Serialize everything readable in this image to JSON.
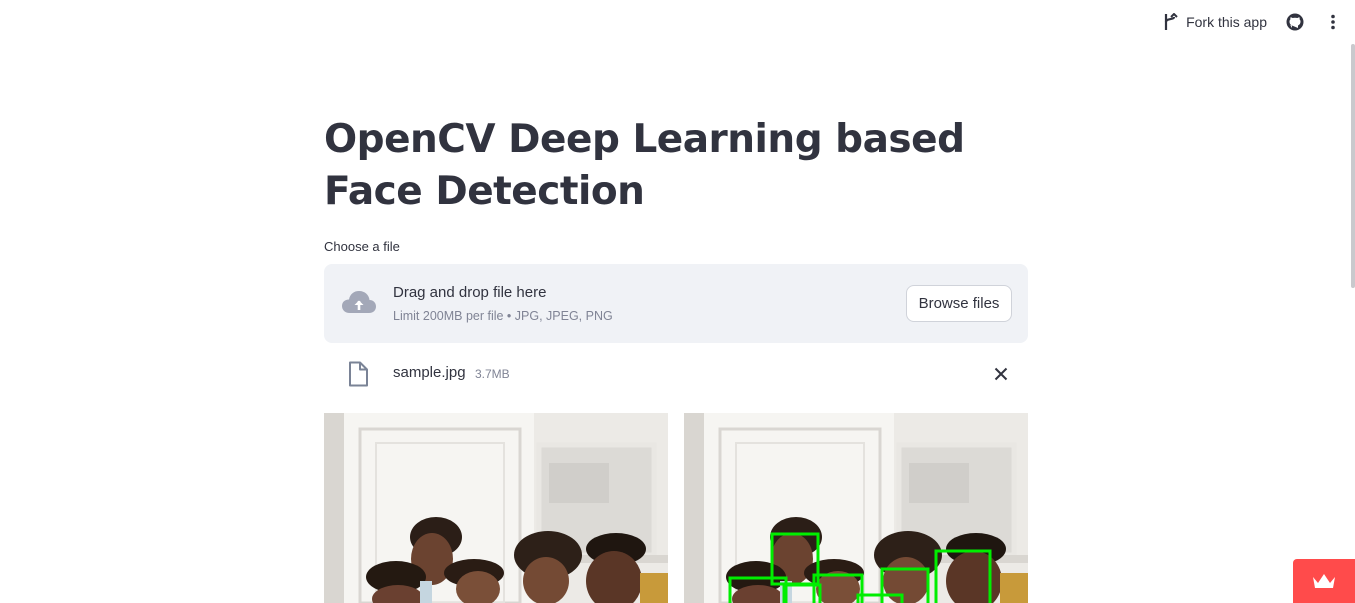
{
  "toolbar": {
    "fork_label": "Fork this app",
    "icons": [
      "fork-icon",
      "github-icon",
      "more-vertical-icon"
    ]
  },
  "page": {
    "title": "OpenCV Deep Learning based Face Detection"
  },
  "uploader": {
    "label": "Choose a file",
    "drop_text": "Drag and drop file here",
    "limit_text": "Limit 200MB per file • JPG, JPEG, PNG",
    "browse_label": "Browse files",
    "icon": "cloud-upload-icon"
  },
  "uploaded_file": {
    "name": "sample.jpg",
    "size": "3.7MB",
    "icon": "file-icon"
  },
  "images": {
    "left": "original-image",
    "right": "detected-faces-image",
    "box_color": "#00ff00"
  },
  "colors": {
    "text": "#31333f",
    "muted": "#808495",
    "dropzone_bg": "#f0f2f6",
    "brand": "#ff4b4b"
  }
}
